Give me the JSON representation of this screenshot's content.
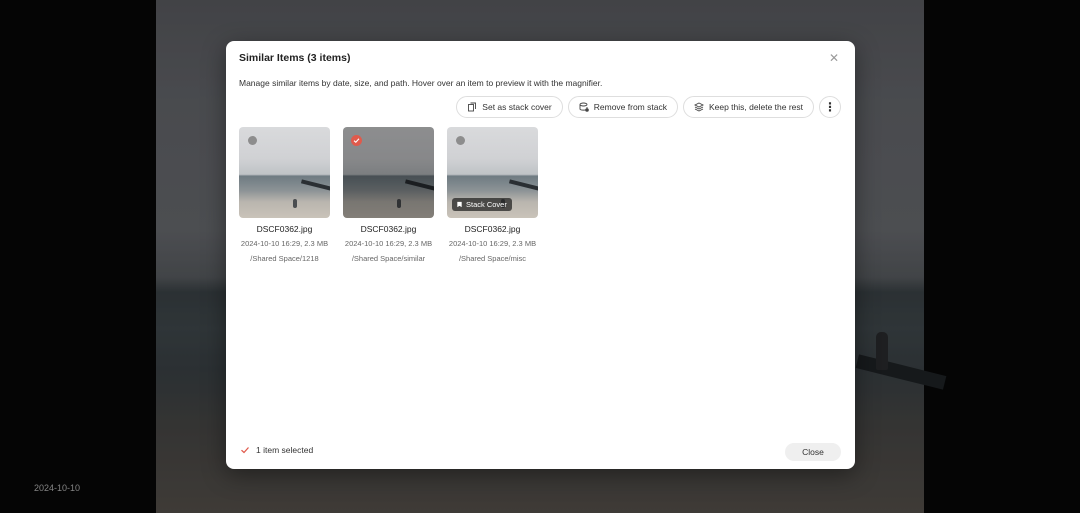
{
  "viewer": {
    "date": "2024-10-10"
  },
  "modal": {
    "title": "Similar Items (3 items)",
    "description": "Manage similar items by date, size, and path. Hover over an item to preview it with the magnifier.",
    "close_icon": "close-icon"
  },
  "toolbar": {
    "set_cover_label": "Set as stack cover",
    "remove_label": "Remove from stack",
    "keep_label": "Keep this, delete the rest",
    "more_label": "⋮"
  },
  "items": [
    {
      "name": "DSCF0362.jpg",
      "meta": "2024-10-10 16:29, 2.3 MB",
      "path": "/Shared Space/1218",
      "selected": false,
      "cover": false
    },
    {
      "name": "DSCF0362.jpg",
      "meta": "2024-10-10 16:29, 2.3 MB",
      "path": "/Shared Space/similar",
      "selected": true,
      "cover": false
    },
    {
      "name": "DSCF0362.jpg",
      "meta": "2024-10-10 16:29, 2.3 MB",
      "path": "/Shared Space/misc",
      "selected": false,
      "cover": true,
      "cover_label": "Stack Cover"
    }
  ],
  "footer": {
    "status": "1 item selected",
    "close_label": "Close"
  },
  "colors": {
    "accent": "#e05a4c",
    "overlay": "#000000"
  }
}
